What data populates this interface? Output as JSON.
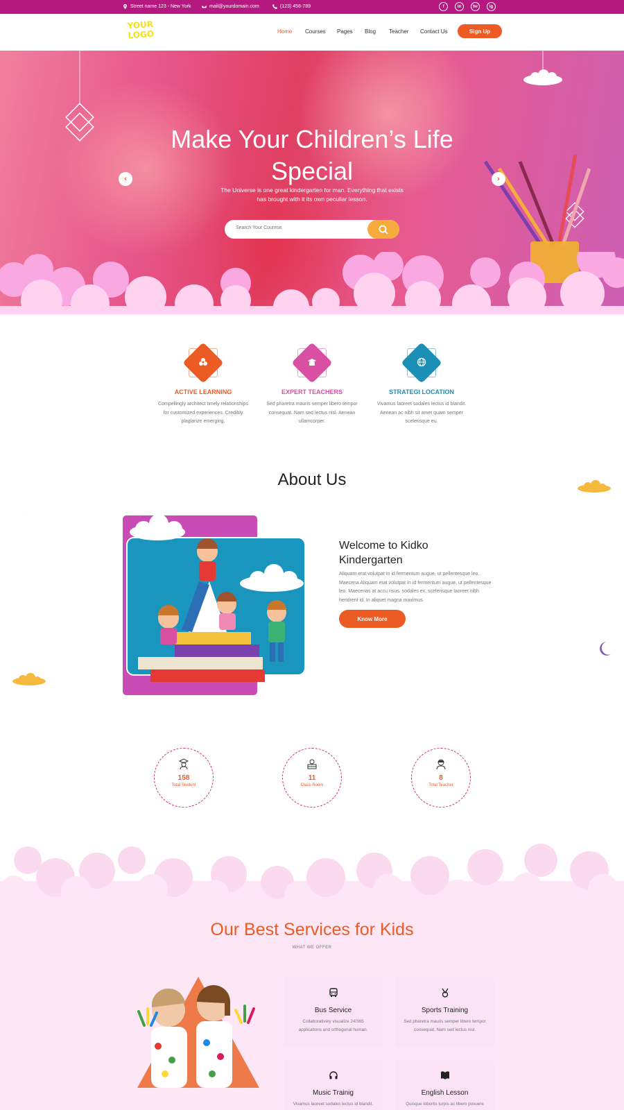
{
  "topbar": {
    "address": "Street name 123 - New York",
    "email": "mail@yourdomain.com",
    "phone": "(123) 456-789",
    "socials": [
      "f",
      "in",
      "tw",
      "ig"
    ]
  },
  "nav": {
    "logo_line1": "YOUR",
    "logo_line2": "LOGO",
    "items": [
      "Home",
      "Courses",
      "Pages",
      "Blog",
      "Teacher",
      "Contact Us"
    ],
    "active_item": "Home",
    "signup_label": "Sign Up"
  },
  "hero": {
    "title_line1": "Make Your Children’s Life",
    "title_line2": "Special",
    "subtitle_line1": "The Universe is one great kindergarten for man. Everything that exists",
    "subtitle_line2": "has brought with it its own peculiar lesson.",
    "search_placeholder": "Search Your Courese"
  },
  "features": [
    {
      "title": "ACTIVE LEARNING",
      "text": "Compellingly architect timely relationships for customized experiences. Credibly plagiarize emerging.",
      "color": "#ed5b24",
      "icon": "atom-icon"
    },
    {
      "title": "EXPERT TEACHERS",
      "text": "Sed pharetra mauris semper libero tempor consequat. Nam sed lectus nisl. Aenean ullamcorper.",
      "color": "#d94fa2",
      "icon": "graduate-icon"
    },
    {
      "title": "STRATEGI LOCATION",
      "text": "Vivamus laoreet sodales lectus id blandit. Aenean ac nibh sit amet quam semper scelerisque eu.",
      "color": "#1b8fb5",
      "icon": "globe-icon"
    }
  ],
  "about": {
    "title": "About Us",
    "heading_line1": "Welcome to Kidko",
    "heading_line2": "Kindergarten",
    "text": "Aliquam erat volutpat In id fermentum augue, ut pellentesque leo. Maecena Aliquam erat volutpat In id fermentum augue, ut pellentesque leo. Maecenas at accu risus. sodales ex, scelerisque laoreet nibh hendrerit id. In aliquet magna maximus.",
    "button": "Know More"
  },
  "stats": [
    {
      "value": "158",
      "label": "Total Student",
      "icon": "student-icon"
    },
    {
      "value": "11",
      "label": "Class Room",
      "icon": "classroom-icon"
    },
    {
      "value": "8",
      "label": "Total Teacher",
      "icon": "teacher-icon"
    }
  ],
  "services": {
    "title": "Our Best Services for Kids",
    "subtitle": "WHAT WE OFFER",
    "cards": [
      {
        "title": "Bus Service",
        "text": "Collaboratively visualize 24/365 applications and orthogonal human.",
        "icon": "bus-icon"
      },
      {
        "title": "Sports Training",
        "text": "Sed pharetra mauris semper libero tempor consequat. Nam sed lectus nisl.",
        "icon": "medal-icon"
      },
      {
        "title": "Music Trainig",
        "text": "Vivamus laoreet sodales lectus id blandit. Aenean ac nibh sit amet quam",
        "icon": "headphones-icon"
      },
      {
        "title": "English Lesson",
        "text": "Quisque lobortis turpis ac libero posuere iaculis. In justo dui, vehicula",
        "icon": "book-icon"
      }
    ]
  },
  "colors": {
    "primary": "#ed5b24",
    "magenta": "#b5197f",
    "pink_light": "#fbe3f6",
    "teal": "#1b8fb5",
    "yellow": "#f5ac3d"
  }
}
